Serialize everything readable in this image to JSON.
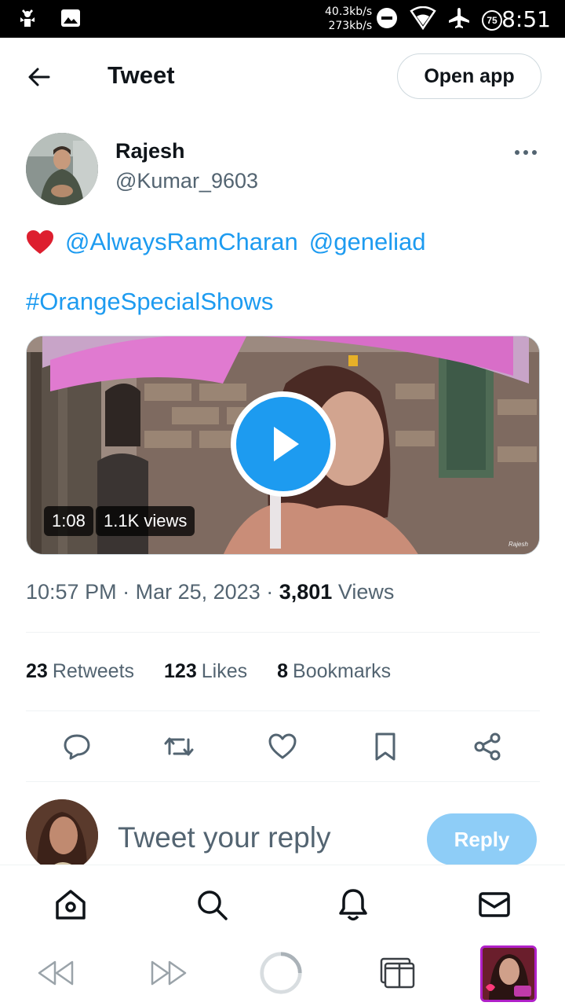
{
  "status_bar": {
    "net_up": "40.3kb/s",
    "net_down": "273kb/s",
    "battery": "75",
    "time": "8:51"
  },
  "header": {
    "title": "Tweet",
    "open_app_label": "Open app"
  },
  "author": {
    "name": "Rajesh",
    "handle": "@Kumar_9603"
  },
  "tweet": {
    "mention_1": "@AlwaysRamCharan",
    "mention_2": "@geneliad",
    "hashtag": "#OrangeSpecialShows",
    "media": {
      "duration": "1:08",
      "views_overlay": "1.1K views",
      "watermark": "Rajesh"
    }
  },
  "meta": {
    "time": "10:57 PM",
    "date": "Mar 25, 2023",
    "views_count": "3,801",
    "views_label": "Views",
    "separator": "·"
  },
  "stats": {
    "retweets_count": "23",
    "retweets_label": "Retweets",
    "likes_count": "123",
    "likes_label": "Likes",
    "bookmarks_count": "8",
    "bookmarks_label": "Bookmarks"
  },
  "reply": {
    "placeholder": "Tweet your reply",
    "button_label": "Reply"
  },
  "colors": {
    "accent": "#1d9bf0",
    "reply_button_disabled": "#8ecdf7",
    "secondary_text": "#536471",
    "heart": "#dd1f2f"
  },
  "icons": {
    "back": "arrow-left-icon",
    "more": "more-horizontal-icon",
    "reply": "comment-icon",
    "retweet": "retweet-icon",
    "like": "heart-icon",
    "bookmark": "bookmark-icon",
    "share": "share-icon",
    "home": "home-icon",
    "search": "search-icon",
    "notifications": "bell-icon",
    "messages": "mail-icon"
  }
}
